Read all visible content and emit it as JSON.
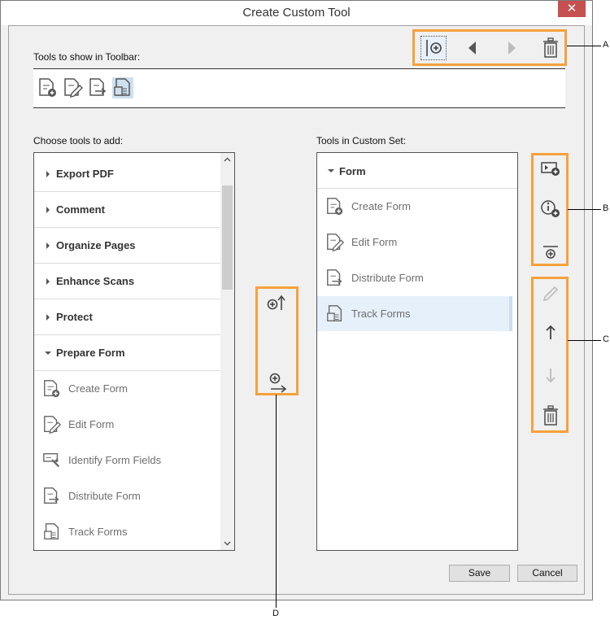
{
  "window": {
    "title": "Create Custom Tool",
    "close_glyph": "✕"
  },
  "toolbar": {
    "label": "Tools to show in Toolbar:",
    "top_buttons": [
      {
        "name": "add-separator-icon"
      },
      {
        "name": "move-left-icon"
      },
      {
        "name": "move-right-icon"
      },
      {
        "name": "delete-icon"
      }
    ],
    "icons": [
      "create-form-icon",
      "edit-form-icon",
      "distribute-form-icon",
      "track-forms-icon"
    ]
  },
  "choose": {
    "label": "Choose tools to add:",
    "categories": [
      "Export PDF",
      "Comment",
      "Organize Pages",
      "Enhance Scans",
      "Protect",
      "Prepare Form"
    ],
    "items": [
      "Create Form",
      "Edit Form",
      "Identify Form Fields",
      "Distribute Form",
      "Track Forms"
    ]
  },
  "custom": {
    "label": "Tools in Custom Set:",
    "category": "Form",
    "items": [
      "Create Form",
      "Edit Form",
      "Distribute Form",
      "Track Forms"
    ],
    "selected": "Track Forms"
  },
  "actions": {
    "save": "Save",
    "cancel": "Cancel"
  },
  "callouts": {
    "a": "A",
    "b": "B",
    "c": "C",
    "d": "D"
  },
  "colors": {
    "highlight": "#f5a13d",
    "close_red": "#c75050",
    "selection": "#e5f0fa"
  }
}
